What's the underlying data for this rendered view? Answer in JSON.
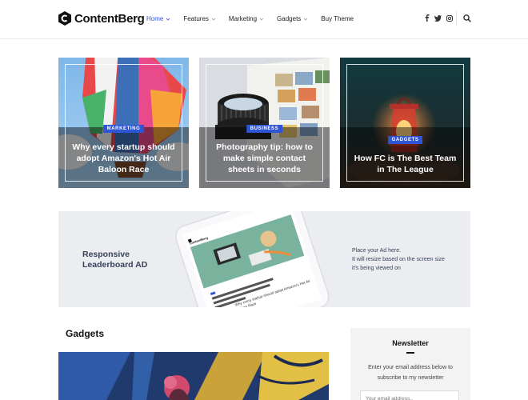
{
  "brand": {
    "name": "ContentBerg",
    "accent": "#2e55d6"
  },
  "nav": [
    {
      "label": "Home",
      "dropdown": true,
      "active": true
    },
    {
      "label": "Features",
      "dropdown": true,
      "active": false
    },
    {
      "label": "Marketing",
      "dropdown": true,
      "active": false
    },
    {
      "label": "Gadgets",
      "dropdown": true,
      "active": false
    },
    {
      "label": "Buy Theme",
      "dropdown": false,
      "active": false
    }
  ],
  "social": [
    "facebook-icon",
    "twitter-icon",
    "instagram-icon"
  ],
  "cards": [
    {
      "badge": "MARKETING",
      "title": "Why every startup should adopt Amazon's Hot Air Baloon Race"
    },
    {
      "badge": "BUSINESS",
      "title": "Photography tip: how to make simple contact sheets in seconds"
    },
    {
      "badge": "GADGETS",
      "title": "How FC is The Best Team in The League"
    }
  ],
  "ad": {
    "left_line1": "Responsive",
    "left_line2": "Leaderboard AD",
    "right_line1": "Place your Ad here.",
    "right_line2": "It will resize based on the screen size",
    "right_line3": "it's being viewed on",
    "phone_brand": "ContentBerg",
    "phone_headline": "Why every startup should adopt Amazon's Hot Air Baloon Race"
  },
  "section": {
    "title": "Gadgets"
  },
  "newsletter": {
    "title": "Newsletter",
    "text": "Enter your email address below to subscribe to my newsletter",
    "placeholder": "Your email address.."
  }
}
